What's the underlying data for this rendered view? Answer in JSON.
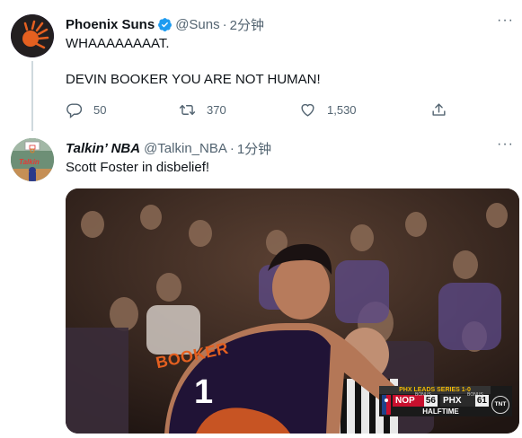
{
  "tweet1": {
    "display_name": "Phoenix Suns",
    "handle": "@Suns",
    "time": "2分钟",
    "line1": "WHAAAAAAAAT.",
    "line2": "DEVIN BOOKER YOU ARE NOT HUMAN!",
    "replies": "50",
    "retweets": "370",
    "likes": "1,530"
  },
  "tweet2": {
    "display_name": "Talkin’ NBA",
    "handle": "@Talkin_NBA",
    "time": "1分钟",
    "text": "Scott Foster in disbelief!",
    "avatar_text": "Talkin"
  },
  "media": {
    "jersey_name": "BOOKER",
    "jersey_number": "1",
    "scorebug": {
      "series": "PHX LEADS SERIES 1-0",
      "team1": "NOP",
      "score1": "56",
      "team2": "PHX",
      "score2": "61",
      "bonus": "BONUS",
      "period": "HALFTIME",
      "network": "TNT"
    }
  },
  "colors": {
    "verified": "#1d9bf0",
    "secondary_text": "#536471",
    "suns_orange": "#e56020",
    "suns_purple": "#1d1160"
  }
}
